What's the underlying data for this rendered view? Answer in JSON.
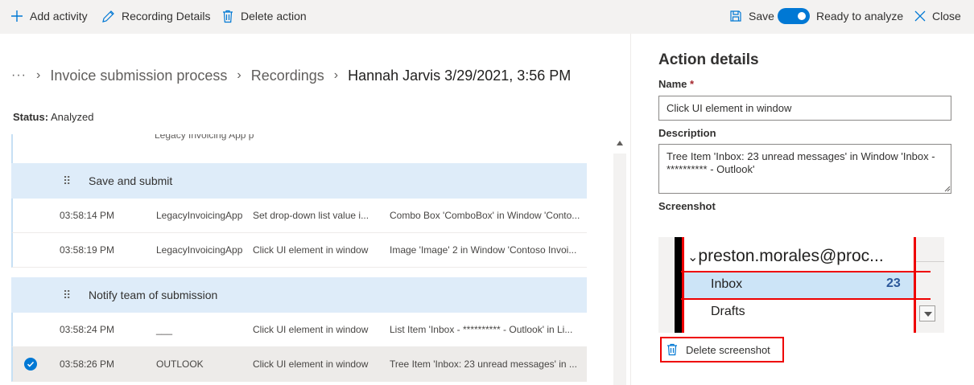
{
  "toolbar": {
    "add_activity": "Add activity",
    "recording_details": "Recording Details",
    "delete_action": "Delete action",
    "save": "Save",
    "ready_to_analyze": "Ready to analyze",
    "ready_to_analyze_on": true,
    "close": "Close",
    "icons": [
      "plus-icon",
      "pencil-icon",
      "trash-icon",
      "save-icon",
      "close-icon"
    ]
  },
  "breadcrumb": {
    "ellipsis": "···",
    "items": [
      "Invoice submission process",
      "Recordings"
    ],
    "current": "Hannah Jarvis 3/29/2021, 3:56 PM"
  },
  "status": {
    "label": "Status:",
    "value": "Analyzed"
  },
  "list": {
    "cut_row_text": "Legacy Invoicing App p",
    "groups": [
      {
        "title": "Save and submit",
        "rows": [
          {
            "time": "03:58:14 PM",
            "app": "LegacyInvoicingApp",
            "action": "Set drop-down list value i...",
            "target": "Combo Box 'ComboBox' in Window 'Conto...",
            "selected": false
          },
          {
            "time": "03:58:19 PM",
            "app": "LegacyInvoicingApp",
            "action": "Click UI element in window",
            "target": "Image 'Image' 2 in Window 'Contoso Invoi...",
            "selected": false
          }
        ]
      },
      {
        "title": "Notify team of submission",
        "rows": [
          {
            "time": "03:58:24 PM",
            "app": "___",
            "action": "Click UI element in window",
            "target": "List Item 'Inbox - ********** - Outlook' in Li...",
            "selected": false
          },
          {
            "time": "03:58:26 PM",
            "app": "OUTLOOK",
            "action": "Click UI element in window",
            "target": "Tree Item 'Inbox: 23 unread messages' in ...",
            "selected": true
          }
        ]
      }
    ]
  },
  "details": {
    "title": "Action details",
    "name_label": "Name",
    "required_mark": "*",
    "name_value": "Click UI element in window",
    "description_label": "Description",
    "description_value": "Tree Item 'Inbox: 23 unread messages' in Window 'Inbox - ********** - Outlook'",
    "screenshot_label": "Screenshot",
    "screenshot": {
      "account": "preston.morales@proc...",
      "inbox": "Inbox",
      "count": "23",
      "drafts": "Drafts"
    },
    "delete_screenshot": "Delete screenshot"
  },
  "colors": {
    "accent": "#0078d4",
    "group_bg": "#deecf9",
    "selected_row": "#edebe9",
    "highlight_red": "#e00000"
  }
}
